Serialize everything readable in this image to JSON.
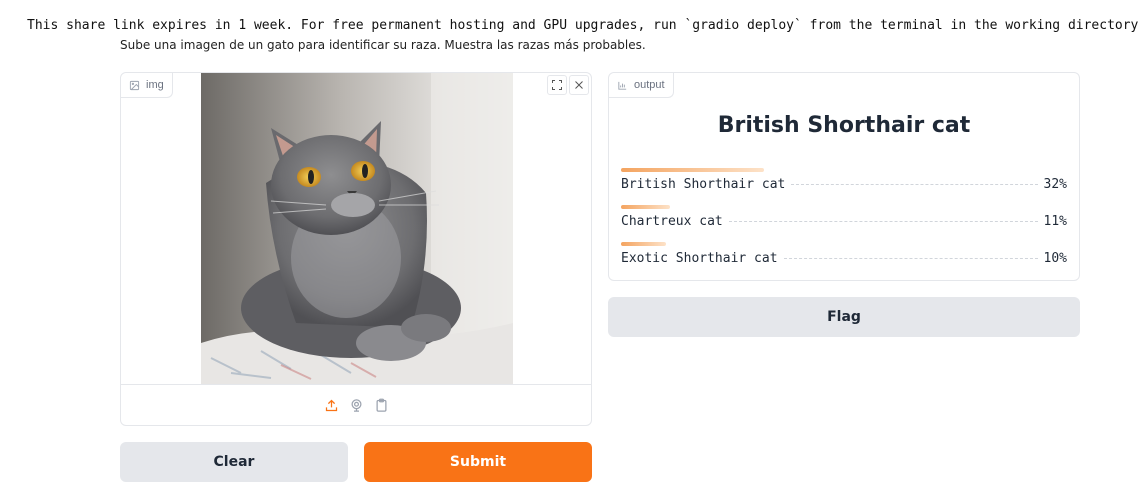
{
  "notice": "This share link expires in 1 week. For free permanent hosting and GPU upgrades, run `gradio deploy` from the terminal in the working directory to",
  "description": "Sube una imagen de un gato para identificar su raza. Muestra las razas más probables.",
  "input_panel": {
    "label": "img",
    "image_subject": "gray British Shorthair cat with orange eyes, sitting on a patterned cushion by a window",
    "controls": [
      "fullscreen-icon",
      "close-icon"
    ],
    "sources": [
      "upload-icon",
      "webcam-icon",
      "clipboard-icon"
    ]
  },
  "output_panel": {
    "label": "output",
    "top_label": "British Shorthair cat",
    "confidences": [
      {
        "label": "British Shorthair cat",
        "value": "32%",
        "fraction": 0.32
      },
      {
        "label": "Chartreux cat",
        "value": "11%",
        "fraction": 0.11
      },
      {
        "label": "Exotic Shorthair cat",
        "value": "10%",
        "fraction": 0.1
      }
    ]
  },
  "buttons": {
    "flag": "Flag",
    "clear": "Clear",
    "submit": "Submit"
  },
  "colors": {
    "primary": "#f97316",
    "secondary": "#e5e7eb"
  }
}
